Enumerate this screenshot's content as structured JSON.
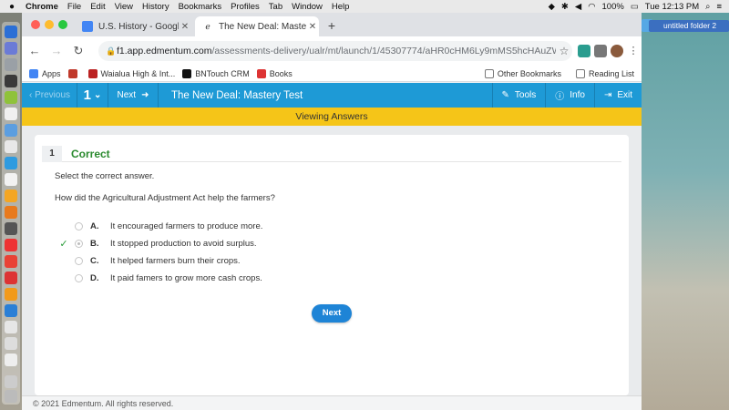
{
  "menubar": {
    "app": "Chrome",
    "items": [
      "File",
      "Edit",
      "View",
      "History",
      "Bookmarks",
      "Profiles",
      "Tab",
      "Window",
      "Help"
    ],
    "battery": "100%",
    "clock": "Tue 12:13 PM"
  },
  "desktop": {
    "folder_label": "untitled folder 2"
  },
  "tabs": [
    {
      "title": "U.S. History - Google Docs",
      "icon": "google-docs-icon",
      "active": false
    },
    {
      "title": "The New Deal: Mastery Test",
      "icon": "edmentum-icon",
      "active": true
    }
  ],
  "omnibox": {
    "host": "f1.app.edmentum.com",
    "path": "/assessments-delivery/ualr/mt/launch/1/45307774/aHR0cHM6Ly9mMS5hcHAuZWRtZW50dW0uY29tL2Fzc2..."
  },
  "bookmarks": {
    "items": [
      "Apps",
      "",
      "Waialua High & Int...",
      "BNTouch CRM",
      "Books"
    ],
    "other": "Other Bookmarks",
    "reading": "Reading List"
  },
  "assessment": {
    "previous": "Previous",
    "question_number": "1",
    "next_top": "Next",
    "title": "The New Deal: Mastery Test",
    "tools": "Tools",
    "info": "Info",
    "exit": "Exit",
    "banner": "Viewing Answers"
  },
  "question": {
    "number": "1",
    "status": "Correct",
    "instructions": "Select the correct answer.",
    "prompt": "How did the Agricultural Adjustment Act help the farmers?",
    "options": [
      {
        "letter": "A.",
        "text": "It encouraged farmers to produce more.",
        "selected": false
      },
      {
        "letter": "B.",
        "text": "It stopped production to avoid surplus.",
        "selected": true
      },
      {
        "letter": "C.",
        "text": "It helped farmers burn their crops.",
        "selected": false
      },
      {
        "letter": "D.",
        "text": "It paid famers to grow more cash crops.",
        "selected": false
      }
    ],
    "next_button": "Next"
  },
  "footer": {
    "copyright": "© 2021 Edmentum. All rights reserved."
  },
  "colors": {
    "assessment_bar": "#1e9ad6",
    "banner": "#f5c518",
    "correct": "#2a8a2e",
    "next_button": "#1e84d6"
  }
}
